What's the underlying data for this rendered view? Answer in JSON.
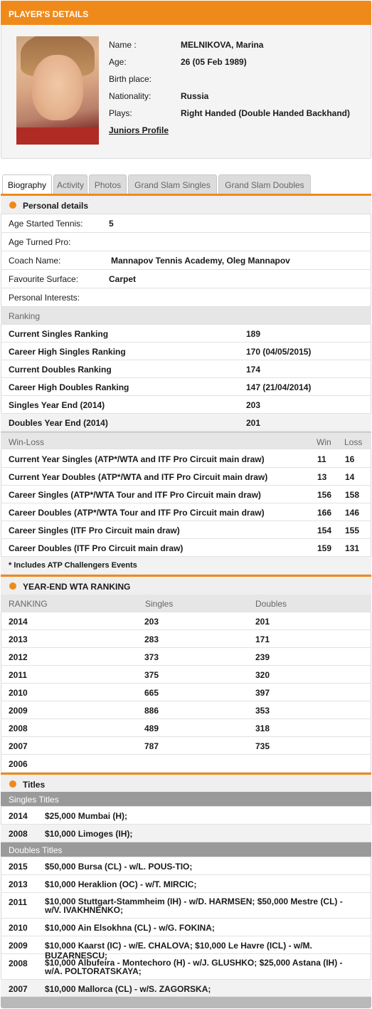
{
  "header": {
    "title": "PLAYER'S DETAILS"
  },
  "player": {
    "fields": [
      {
        "label": "Name :",
        "value": "MELNIKOVA, Marina"
      },
      {
        "label": "Age:",
        "value": "26 (05 Feb 1989)"
      },
      {
        "label": "Birth place:",
        "value": ""
      },
      {
        "label": "Nationality:",
        "value": "Russia"
      },
      {
        "label": "Plays:",
        "value": "Right Handed (Double Handed Backhand)"
      }
    ],
    "juniors_link": "Juniors Profile"
  },
  "tabs": [
    "Biography",
    "Activity",
    "Photos",
    "Grand Slam Singles",
    "Grand Slam Doubles"
  ],
  "personal": {
    "title": "Personal details",
    "rows": [
      {
        "label": "Age Started Tennis:",
        "value": "5"
      },
      {
        "label": "Age Turned Pro:",
        "value": ""
      },
      {
        "label": "Coach Name:",
        "value": "Mannapov Tennis Academy, Oleg Mannapov"
      },
      {
        "label": "Favourite Surface:",
        "value": "Carpet"
      },
      {
        "label": "Personal Interests:",
        "value": ""
      }
    ]
  },
  "ranking": {
    "title": "Ranking",
    "rows": [
      {
        "label": "Current Singles Ranking",
        "value": "189"
      },
      {
        "label": "Career High Singles Ranking",
        "value": "170 (04/05/2015)"
      },
      {
        "label": "Current Doubles Ranking",
        "value": "174"
      },
      {
        "label": "Career High Doubles Ranking",
        "value": "147 (21/04/2014)"
      },
      {
        "label": "Singles Year End (2014)",
        "value": "203"
      },
      {
        "label": "Doubles Year End (2014)",
        "value": "201"
      }
    ]
  },
  "winloss": {
    "title": "Win-Loss",
    "win_header": "Win",
    "loss_header": "Loss",
    "rows": [
      {
        "label": "Current Year Singles (ATP*/WTA and ITF Pro Circuit main draw)",
        "win": "11",
        "loss": "16"
      },
      {
        "label": "Current Year Doubles (ATP*/WTA and ITF Pro Circuit main draw)",
        "win": "13",
        "loss": "14"
      },
      {
        "label": "Career Singles (ATP*/WTA Tour and ITF Pro Circuit main draw)",
        "win": "156",
        "loss": "158"
      },
      {
        "label": "Career Doubles (ATP*/WTA Tour and ITF Pro Circuit main draw)",
        "win": "166",
        "loss": "146"
      },
      {
        "label": "Career Singles (ITF Pro Circuit main draw)",
        "win": "154",
        "loss": "155"
      },
      {
        "label": "Career Doubles (ITF Pro Circuit main draw)",
        "win": "159",
        "loss": "131"
      }
    ],
    "note": "* Includes ATP Challengers Events"
  },
  "yearend": {
    "title": "YEAR-END WTA RANKING",
    "headers": [
      "RANKING",
      "Singles",
      "Doubles"
    ],
    "rows": [
      {
        "year": "2014",
        "singles": "203",
        "doubles": "201"
      },
      {
        "year": "2013",
        "singles": "283",
        "doubles": "171"
      },
      {
        "year": "2012",
        "singles": "373",
        "doubles": "239"
      },
      {
        "year": "2011",
        "singles": "375",
        "doubles": "320"
      },
      {
        "year": "2010",
        "singles": "665",
        "doubles": "397"
      },
      {
        "year": "2009",
        "singles": "886",
        "doubles": "353"
      },
      {
        "year": "2008",
        "singles": "489",
        "doubles": "318"
      },
      {
        "year": "2007",
        "singles": "787",
        "doubles": "735"
      },
      {
        "year": "2006",
        "singles": "",
        "doubles": ""
      }
    ]
  },
  "titles": {
    "title": "Titles",
    "singles_header": "Singles Titles",
    "singles": [
      {
        "year": "2014",
        "text": "$25,000 Mumbai (H);"
      },
      {
        "year": "2008",
        "text": "$10,000 Limoges (IH);"
      }
    ],
    "doubles_header": "Doubles Titles",
    "doubles": [
      {
        "year": "2015",
        "text": "$50,000 Bursa (CL) - w/L. POUS-TIO;"
      },
      {
        "year": "2013",
        "text": "$10,000 Heraklion (OC) - w/T. MIRCIC;"
      },
      {
        "year": "2011",
        "text": "$10,000 Stuttgart-Stammheim (IH) - w/D. HARMSEN; $50,000 Mestre (CL) - w/V. IVAKHNENKO;"
      },
      {
        "year": "2010",
        "text": "$10,000 Ain Elsokhna (CL) - w/G. FOKINA;"
      },
      {
        "year": "2009",
        "text": "$10,000 Kaarst (IC) - w/E. CHALOVA; $10,000 Le Havre (ICL) - w/M. BUZARNESCU;"
      },
      {
        "year": "2008",
        "text": "$10,000 Albufeira - Montechoro (H) - w/J. GLUSHKO; $25,000 Astana (IH) - w/A. POLTORATSKAYA;"
      },
      {
        "year": "2007",
        "text": "$10,000 Mallorca (CL) - w/S. ZAGORSKA;"
      }
    ]
  }
}
